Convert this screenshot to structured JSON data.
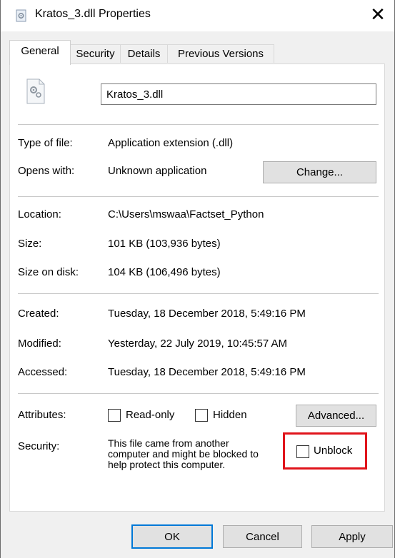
{
  "window": {
    "title": "Kratos_3.dll Properties",
    "close_glyph": "✕"
  },
  "tabs": [
    {
      "label": "General",
      "active": true
    },
    {
      "label": "Security",
      "active": false
    },
    {
      "label": "Details",
      "active": false
    },
    {
      "label": "Previous Versions",
      "active": false
    }
  ],
  "general": {
    "file_name": "Kratos_3.dll",
    "file_icon": "dll-gear-file-icon",
    "type_of_file": {
      "label": "Type of file:",
      "value": "Application extension (.dll)"
    },
    "opens_with": {
      "label": "Opens with:",
      "value": "Unknown application",
      "button": "Change..."
    },
    "location": {
      "label": "Location:",
      "value": "C:\\Users\\mswaa\\Factset_Python"
    },
    "size": {
      "label": "Size:",
      "value": "101 KB (103,936 bytes)"
    },
    "size_on_disk": {
      "label": "Size on disk:",
      "value": "104 KB (106,496 bytes)"
    },
    "created": {
      "label": "Created:",
      "value": "Tuesday, 18 December 2018, 5:49:16 PM"
    },
    "modified": {
      "label": "Modified:",
      "value": "Yesterday, 22 July 2019, 10:45:57 AM"
    },
    "accessed": {
      "label": "Accessed:",
      "value": "Tuesday, 18 December 2018, 5:49:16 PM"
    },
    "attributes": {
      "label": "Attributes:",
      "read_only": {
        "label": "Read-only",
        "checked": false
      },
      "hidden": {
        "label": "Hidden",
        "checked": false
      },
      "advanced_button": "Advanced..."
    },
    "security": {
      "label": "Security:",
      "lines": [
        "This file came from another",
        "computer and might be blocked to",
        "help protect this computer."
      ],
      "unblock": {
        "label": "Unblock",
        "checked": false
      }
    }
  },
  "footer": {
    "ok": "OK",
    "cancel": "Cancel",
    "apply": "Apply"
  },
  "colors": {
    "highlight_box": "#e0141b",
    "primary_button_border": "#0078d7"
  }
}
